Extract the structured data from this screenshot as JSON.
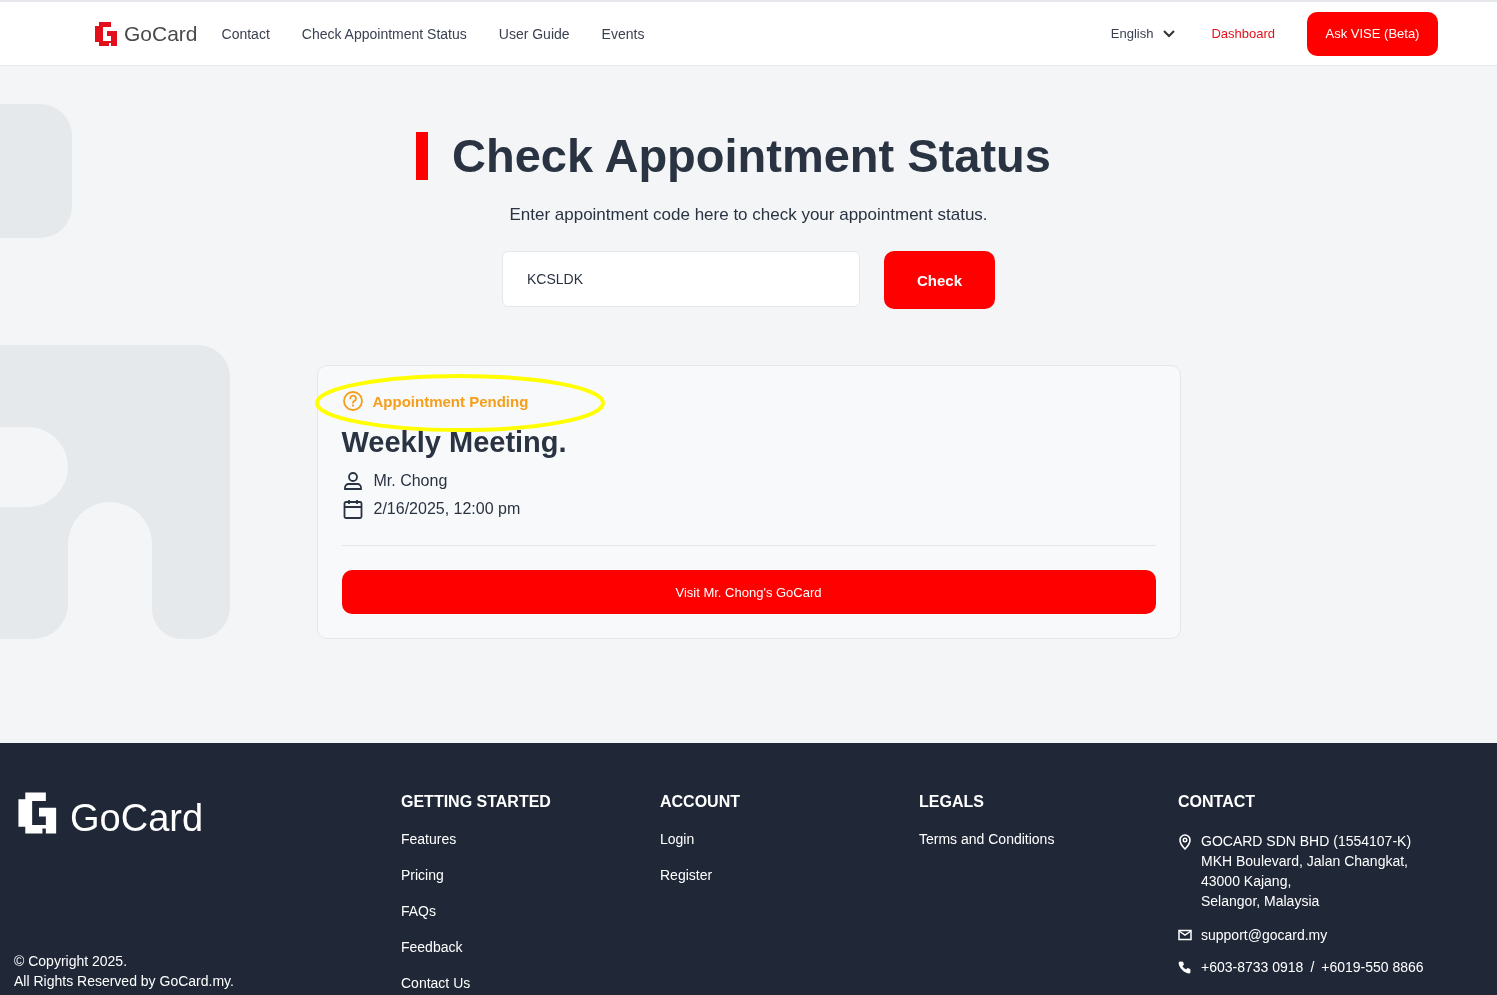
{
  "header": {
    "logo": "GoCard",
    "nav": [
      {
        "label": "Contact"
      },
      {
        "label": "Check Appointment Status"
      },
      {
        "label": "User Guide"
      },
      {
        "label": "Events"
      }
    ],
    "language": "English",
    "dashboard": "Dashboard",
    "ask_button": "Ask VISE (Beta)"
  },
  "main": {
    "title": "Check Appointment Status",
    "subtitle": "Enter appointment code here to check your appointment status.",
    "code_field": {
      "value": "KCSLDK"
    },
    "check_button": "Check"
  },
  "result": {
    "status": "Appointment Pending",
    "title": "Weekly Meeting.",
    "host": "Mr. Chong",
    "datetime": "2/16/2025, 12:00 pm",
    "visit_button": "Visit Mr. Chong's GoCard"
  },
  "annotation": {
    "kind": "ellipse"
  },
  "footer": {
    "logo": "GoCard",
    "copyright": [
      "© Copyright 2025.",
      "All Rights Reserved by GoCard.my."
    ],
    "columns": [
      {
        "heading": "GETTING STARTED",
        "links": [
          "Features",
          "Pricing",
          "FAQs",
          "Feedback",
          "Contact Us"
        ]
      },
      {
        "heading": "ACCOUNT",
        "links": [
          "Login",
          "Register"
        ]
      },
      {
        "heading": "LEGALS",
        "links": [
          "Terms and Conditions"
        ]
      }
    ],
    "contact": {
      "heading": "CONTACT",
      "address": [
        "GOCARD SDN BHD (1554107-K)",
        "MKH Boulevard, Jalan Changkat,",
        "43000 Kajang,",
        "Selangor, Malaysia"
      ],
      "email": "support@gocard.my",
      "phones": [
        "+603-8733 0918",
        "/",
        "+6019-550 8866"
      ]
    }
  }
}
